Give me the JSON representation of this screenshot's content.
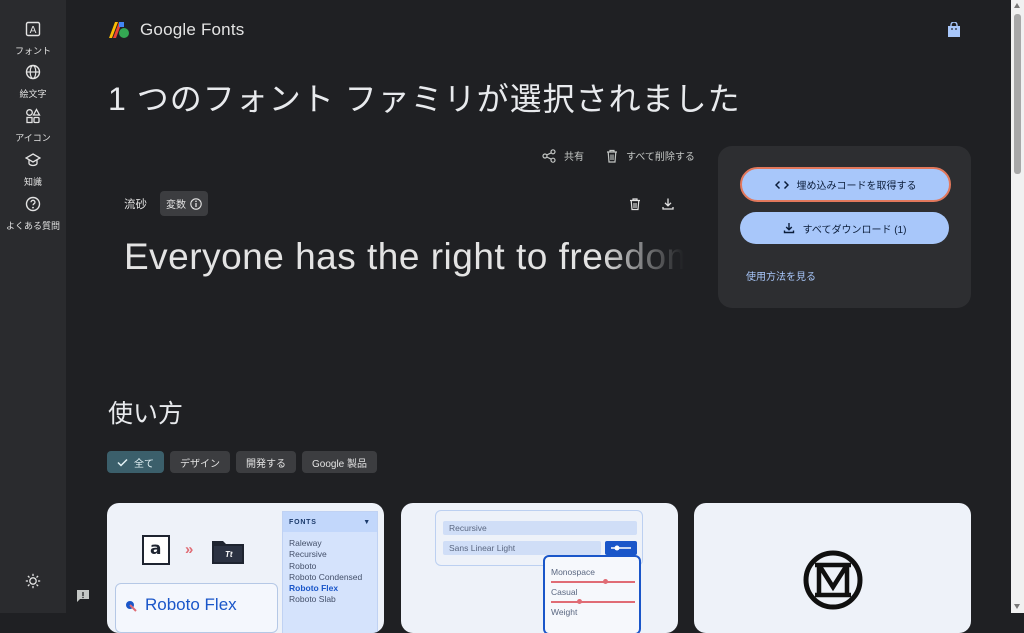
{
  "rail": {
    "items": [
      {
        "label": "フォント",
        "icon": "font-icon"
      },
      {
        "label": "絵文字",
        "icon": "globe-icon"
      },
      {
        "label": "アイコン",
        "icon": "shapes-icon"
      },
      {
        "label": "知識",
        "icon": "school-icon"
      },
      {
        "label": "よくある質問",
        "icon": "help-icon"
      }
    ],
    "theme_icon": "brightness-icon",
    "feedback_icon": "feedback-icon"
  },
  "header": {
    "logo_text": "Google Fonts",
    "bag_icon": "shopping-bag-icon"
  },
  "selection": {
    "headline": "1 つのフォント ファミリが選択されました",
    "share_label": "共有",
    "delete_all_label": "すべて削除する"
  },
  "font_card": {
    "name": "流砂",
    "variable_label": "変数",
    "preview_text": "Everyone has the right to freedom"
  },
  "panel": {
    "embed_label": "埋め込みコードを取得する",
    "download_label": "すべてダウンロード (1)",
    "usage_link": "使用方法を見る"
  },
  "usage": {
    "title": "使い方",
    "filters": [
      {
        "label": "全て",
        "active": true
      },
      {
        "label": "デザイン",
        "active": false
      },
      {
        "label": "開発する",
        "active": false
      },
      {
        "label": "Google 製品",
        "active": false
      }
    ]
  },
  "tile1": {
    "fonts_header": "FONTS",
    "font_list": [
      "Raleway",
      "Recursive",
      "Roboto",
      "Roboto Condensed",
      "Roboto Flex",
      "Roboto Slab"
    ],
    "selected_font": "Roboto Flex",
    "big_label": "Roboto Flex",
    "glyph_a": "a",
    "glyph_tt": "Tt"
  },
  "tile2": {
    "row1": "Recursive",
    "row2": "Sans Linear Light",
    "axes": [
      "Monospace",
      "Casual",
      "Weight"
    ]
  },
  "colors": {
    "accent": "#a8c7fa",
    "highlight_border": "#e2785c",
    "active_chip": "#3b5f6b",
    "background": "#1f2023"
  }
}
